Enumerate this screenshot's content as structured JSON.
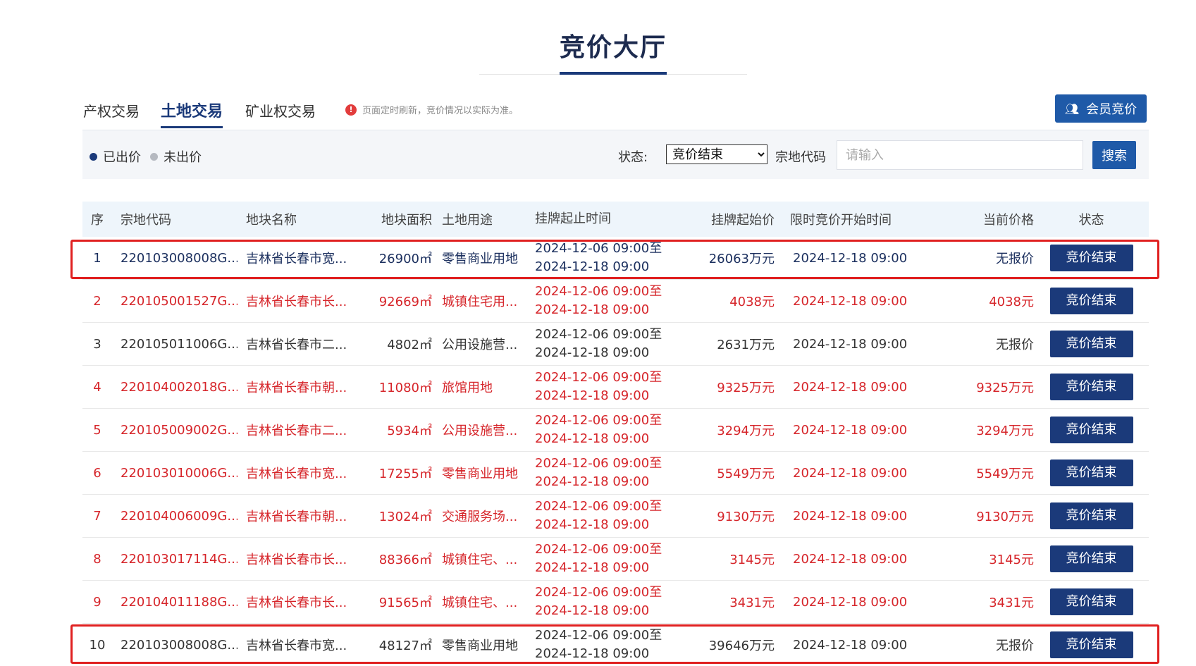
{
  "header": {
    "title": "竞价大厅"
  },
  "tabs": [
    {
      "label": "产权交易",
      "active": false
    },
    {
      "label": "土地交易",
      "active": true
    },
    {
      "label": "矿业权交易",
      "active": false
    }
  ],
  "notice": {
    "icon": "info-icon",
    "text": "页面定时刷新，竞价情况以实际为准。"
  },
  "member_button": {
    "icon": "users-icon",
    "label": "会员竞价"
  },
  "filters": {
    "legend_bid": "已出价",
    "legend_not_bid": "未出价",
    "status_label": "状态:",
    "status_value": "竞价结束",
    "code_label": "宗地代码",
    "code_placeholder": "请输入",
    "search_label": "搜索"
  },
  "colors": {
    "primary": "#1b3a7a",
    "button": "#1f5aa8",
    "red": "#d6252a",
    "highlight": "#e02020",
    "dot_bid": "#1b3a7a",
    "dot_not_bid": "#b5b9c0"
  },
  "table": {
    "columns": [
      "序",
      "宗地代码",
      "地块名称",
      "地块面积",
      "土地用途",
      "挂牌起止时间",
      "挂牌起始价",
      "限时竞价开始时间",
      "当前价格",
      "状态"
    ],
    "rows": [
      {
        "idx": "1",
        "code": "220103008008G...",
        "name": "吉林省长春市宽...",
        "area": "26900㎡",
        "use": "零售商业用地",
        "time1": "2024-12-06 09:00至",
        "time2": "2024-12-18 09:00",
        "start_price": "26063万元",
        "bid_start": "2024-12-18 09:00",
        "current": "无报价",
        "status": "竞价结束",
        "tone": "blue"
      },
      {
        "idx": "2",
        "code": "220105001527G...",
        "name": "吉林省长春市长...",
        "area": "92669㎡",
        "use": "城镇住宅用...",
        "time1": "2024-12-06 09:00至",
        "time2": "2024-12-18 09:00",
        "start_price": "4038元",
        "bid_start": "2024-12-18 09:00",
        "current": "4038元",
        "status": "竞价结束",
        "tone": "red"
      },
      {
        "idx": "3",
        "code": "220105011006G...",
        "name": "吉林省长春市二...",
        "area": "4802㎡",
        "use": "公用设施营...",
        "time1": "2024-12-06 09:00至",
        "time2": "2024-12-18 09:00",
        "start_price": "2631万元",
        "bid_start": "2024-12-18 09:00",
        "current": "无报价",
        "status": "竞价结束",
        "tone": "gray"
      },
      {
        "idx": "4",
        "code": "220104002018G...",
        "name": "吉林省长春市朝...",
        "area": "11080㎡",
        "use": "旅馆用地",
        "time1": "2024-12-06 09:00至",
        "time2": "2024-12-18 09:00",
        "start_price": "9325万元",
        "bid_start": "2024-12-18 09:00",
        "current": "9325万元",
        "status": "竞价结束",
        "tone": "red"
      },
      {
        "idx": "5",
        "code": "220105009002G...",
        "name": "吉林省长春市二...",
        "area": "5934㎡",
        "use": "公用设施营...",
        "time1": "2024-12-06 09:00至",
        "time2": "2024-12-18 09:00",
        "start_price": "3294万元",
        "bid_start": "2024-12-18 09:00",
        "current": "3294万元",
        "status": "竞价结束",
        "tone": "red"
      },
      {
        "idx": "6",
        "code": "220103010006G...",
        "name": "吉林省长春市宽...",
        "area": "17255㎡",
        "use": "零售商业用地",
        "time1": "2024-12-06 09:00至",
        "time2": "2024-12-18 09:00",
        "start_price": "5549万元",
        "bid_start": "2024-12-18 09:00",
        "current": "5549万元",
        "status": "竞价结束",
        "tone": "red"
      },
      {
        "idx": "7",
        "code": "220104006009G...",
        "name": "吉林省长春市朝...",
        "area": "13024㎡",
        "use": "交通服务场...",
        "time1": "2024-12-06 09:00至",
        "time2": "2024-12-18 09:00",
        "start_price": "9130万元",
        "bid_start": "2024-12-18 09:00",
        "current": "9130万元",
        "status": "竞价结束",
        "tone": "red"
      },
      {
        "idx": "8",
        "code": "220103017114G...",
        "name": "吉林省长春市长...",
        "area": "88366㎡",
        "use": "城镇住宅、...",
        "time1": "2024-12-06 09:00至",
        "time2": "2024-12-18 09:00",
        "start_price": "3145元",
        "bid_start": "2024-12-18 09:00",
        "current": "3145元",
        "status": "竞价结束",
        "tone": "red"
      },
      {
        "idx": "9",
        "code": "220104011188G...",
        "name": "吉林省长春市长...",
        "area": "91565㎡",
        "use": "城镇住宅、...",
        "time1": "2024-12-06 09:00至",
        "time2": "2024-12-18 09:00",
        "start_price": "3431元",
        "bid_start": "2024-12-18 09:00",
        "current": "3431元",
        "status": "竞价结束",
        "tone": "red"
      },
      {
        "idx": "10",
        "code": "220103008008G...",
        "name": "吉林省长春市宽...",
        "area": "48127㎡",
        "use": "零售商业用地",
        "time1": "2024-12-06 09:00至",
        "time2": "2024-12-18 09:00",
        "start_price": "39646万元",
        "bid_start": "2024-12-18 09:00",
        "current": "无报价",
        "status": "竞价结束",
        "tone": "gray"
      }
    ]
  }
}
